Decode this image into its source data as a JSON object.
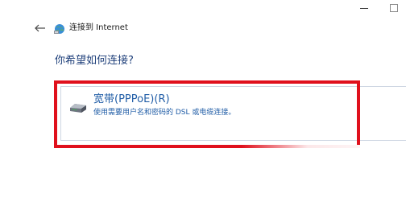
{
  "window": {
    "controls": [
      "minimize",
      "maximize"
    ]
  },
  "header": {
    "back_icon": "back-arrow-icon",
    "wizard_icon": "network-globe-icon",
    "title": "连接到 Internet"
  },
  "page": {
    "heading": "你希望如何连接?"
  },
  "options": [
    {
      "icon": "broadband-modem-icon",
      "title": "宽带(PPPoE)(R)",
      "description": "使用需要用户名和密码的 DSL 或电缆连接。",
      "highlighted": true
    }
  ],
  "colors": {
    "heading": "#1e3f7a",
    "link": "#1f5ca6",
    "highlight": "#e0101c",
    "card_border": "#cfd7e3"
  }
}
